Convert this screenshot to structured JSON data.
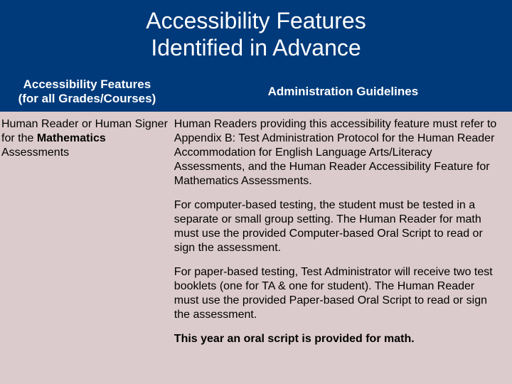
{
  "title": {
    "line1": "Accessibility Features",
    "line2": "Identified in Advance"
  },
  "table": {
    "header": {
      "feature_col_line1": "Accessibility Features",
      "feature_col_line2": "(for all Grades/Courses)",
      "guidelines_col": "Administration Guidelines"
    },
    "row": {
      "feature_prefix": "Human Reader or Human Signer for the ",
      "feature_bold": "Mathematics",
      "feature_suffix": " Assessments",
      "guidelines": {
        "p1": "Human Readers providing this accessibility feature must refer to Appendix B: Test Administration Protocol for the Human Reader Accommodation for English Language Arts/Literacy Assessments, and the Human Reader Accessibility Feature for Mathematics Assessments.",
        "p2": "For computer-based testing, the student must be tested in a separate or small group setting. The Human Reader for math must use the provided Computer-based Oral Script to read or sign the assessment.",
        "p3": "For paper-based testing, Test Administrator will receive two test booklets (one for TA & one for student). The Human Reader must use the provided Paper-based Oral Script to read or sign the assessment.",
        "p4": "This year an oral script is provided for math."
      }
    }
  }
}
